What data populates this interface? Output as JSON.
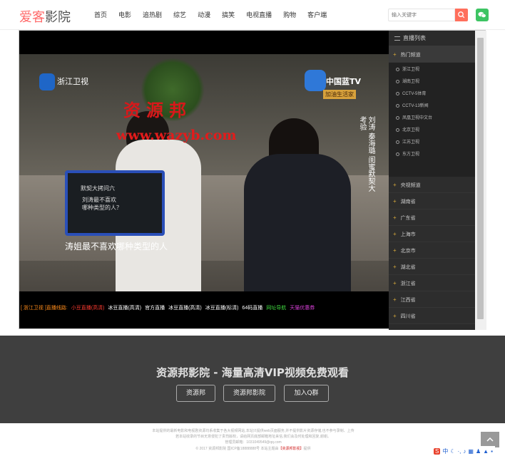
{
  "header": {
    "logo_part1": "爱客",
    "logo_part2": "影院",
    "nav": [
      "首页",
      "电影",
      "追热剧",
      "综艺",
      "动漫",
      "搞笑",
      "电视直播",
      "购物",
      "客户端"
    ],
    "search_placeholder": "输入关键字"
  },
  "video": {
    "channel_left": "浙江卫视",
    "channel_right": "中国蓝TV",
    "channel_right_sub": "加油生活家",
    "watermark_title": "资源邦",
    "watermark_url": "www.wazyb.com",
    "vertical_caption": "刘涛 秦海璐 闺蜜默契大考验",
    "board_line1": "默契大拷问六",
    "board_line2": "刘涛最不喜欢\n哪种类型的人？",
    "subtitle": "涛姐最不喜欢哪种类型的人"
  },
  "lines": {
    "current": "[ 浙江卫视 ]直播线路:",
    "items": [
      "小豆直播(高清)",
      "冰豆直播(高清)",
      "官方直播",
      "冰豆直播(高清)",
      "冰豆直播(标清)",
      "64码直播"
    ],
    "nav_link": "网址导航",
    "coupon_link": "天猫优惠券"
  },
  "sidebar": {
    "title": "直播列表",
    "open_group": "热门频道",
    "channels": [
      "浙江卫视",
      "湖南卫视",
      "CCTV-5体育",
      "CCTV-13新闻",
      "凤凰卫视中文台",
      "北京卫视",
      "江苏卫视",
      "东方卫视"
    ],
    "groups": [
      "央视频道",
      "湖南省",
      "广东省",
      "上海市",
      "北京市",
      "湖北省",
      "浙江省",
      "江西省",
      "四川省"
    ]
  },
  "banner": {
    "title": "资源邦影院 - 海量高清VIP视频免费观看",
    "buttons": [
      "资源邦",
      "资源邦影院",
      "加入Q群"
    ]
  },
  "footer": {
    "line1": "本站提供的最新电影和电视剧资源均系收集于各大视频网站,本站只提供web页面服务,并不提供影片资源存储,也不参与录制、上传",
    "line2": "若本站收录的节目无意侵犯了贵司版权，请给网页底部邮箱地址来信,我们会及时处理和回复,谢谢。",
    "line3": "管理员邮箱：1031049549@qq.com",
    "line4_pre": "© 2017 资源邦影院  国ICP备18888888号  本站主题由",
    "line4_link": "【资源邦影视】",
    "line4_post": "提供"
  },
  "colors": {
    "accent": "#ff6f5c",
    "wechat": "#3dc463",
    "banner_bg": "#3f3f3f",
    "sidebar_bg": "#2b2b2b"
  }
}
